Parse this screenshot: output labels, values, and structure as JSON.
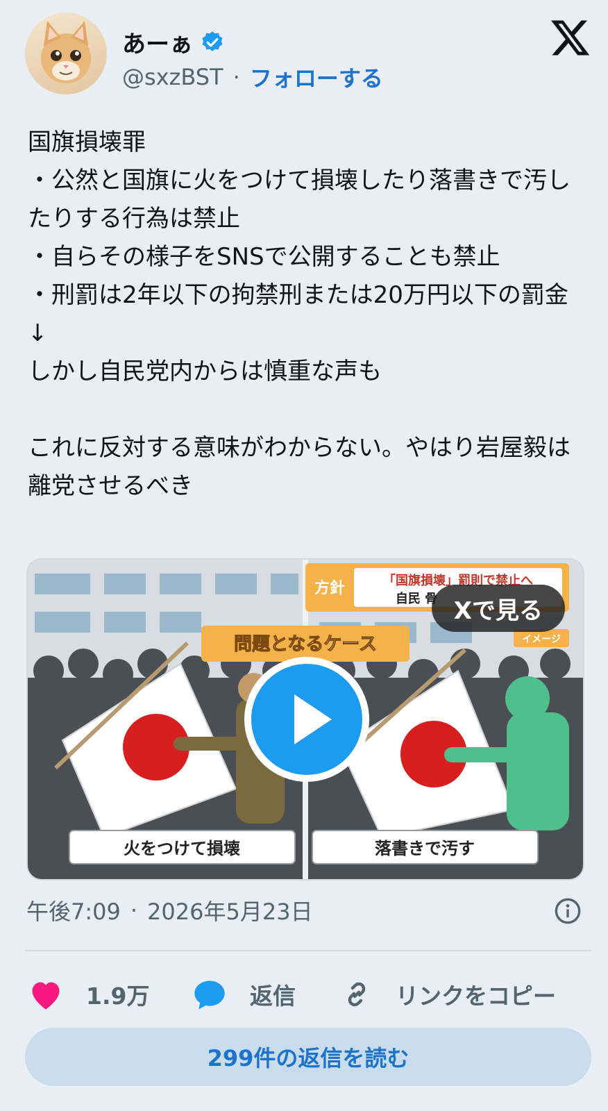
{
  "user": {
    "display_name": "あーぁ",
    "handle": "@sxzBST",
    "separator": "·",
    "follow_label": "フォローする"
  },
  "tweet": {
    "text": "国旗損壊罪\n・公然と国旗に火をつけて損壊したり落書きで汚したりする行為は禁止\n・自らその様子をSNSで公開することも禁止\n・刑罰は2年以下の拘禁刑または20万円以下の罰金\n↓\nしかし自民党内からは慎重な声も\n\nこれに反対する意味がわからない。やはり岩屋毅は離党させるべき"
  },
  "media": {
    "watch_label": "Xで見る",
    "caption_banner": "問題となるケース",
    "policy_tag": "方針",
    "headline": "「国旗損壊」罰則で禁止へ",
    "sub_headline": "自民 骨",
    "image_tag": "イメージ",
    "left_caption": "火をつけて損壊",
    "right_caption": "落書きで汚す"
  },
  "meta": {
    "time": "午後7:09",
    "separator": "·",
    "date": "2026年5月23日"
  },
  "actions": {
    "like_count": "1.9万",
    "reply_label": "返信",
    "copy_link_label": "リンクをコピー"
  },
  "read_replies_label": "299件の返信を読む",
  "colors": {
    "accent": "#1d9bf0",
    "link": "#1d72c9",
    "like": "#f91880",
    "background": "#e8eef4"
  }
}
